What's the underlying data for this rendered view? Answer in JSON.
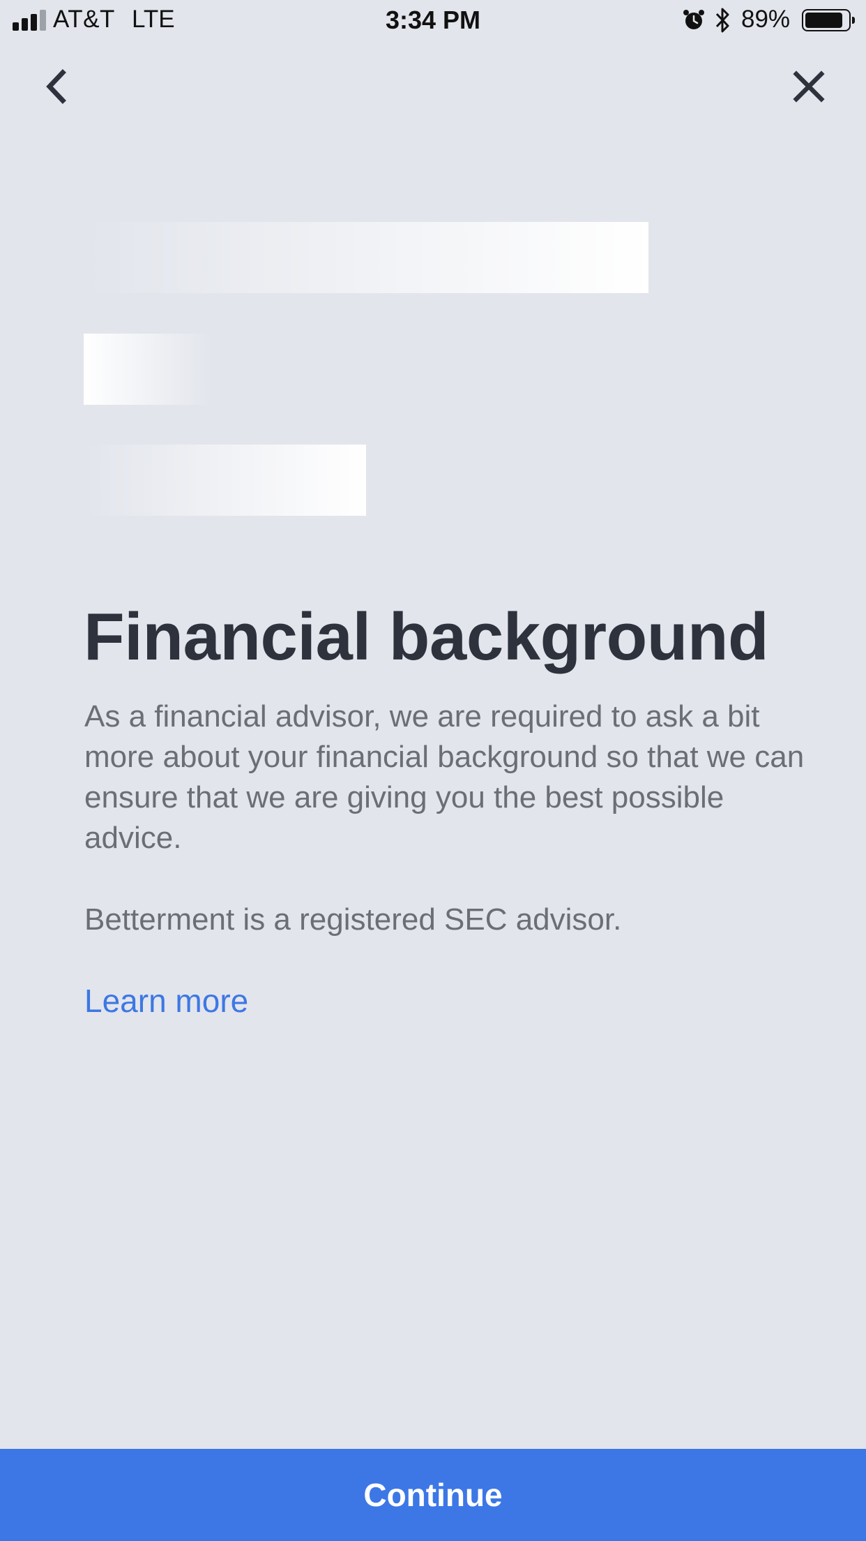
{
  "status_bar": {
    "carrier": "AT&T",
    "network": "LTE",
    "time": "3:34 PM",
    "battery_percent_label": "89%",
    "battery_level": 0.89,
    "signal_bars": 3,
    "signal_bars_total": 4,
    "icons": [
      "alarm-icon",
      "bluetooth-icon",
      "battery-icon"
    ]
  },
  "nav": {
    "back_icon": "chevron-left-icon",
    "close_icon": "close-icon"
  },
  "main": {
    "title": "Financial background",
    "description": "As a financial advisor, we are required to ask a bit more about your financial background so that we can ensure that we are giving you the best possible advice.",
    "registration_note": "Betterment is a registered SEC advisor.",
    "learn_more_label": "Learn more"
  },
  "footer": {
    "continue_label": "Continue"
  },
  "colors": {
    "background": "#e2e5ec",
    "title": "#2e323c",
    "body_text": "#6b6e75",
    "link": "#3d77e3",
    "primary_button": "#3d77e6"
  }
}
